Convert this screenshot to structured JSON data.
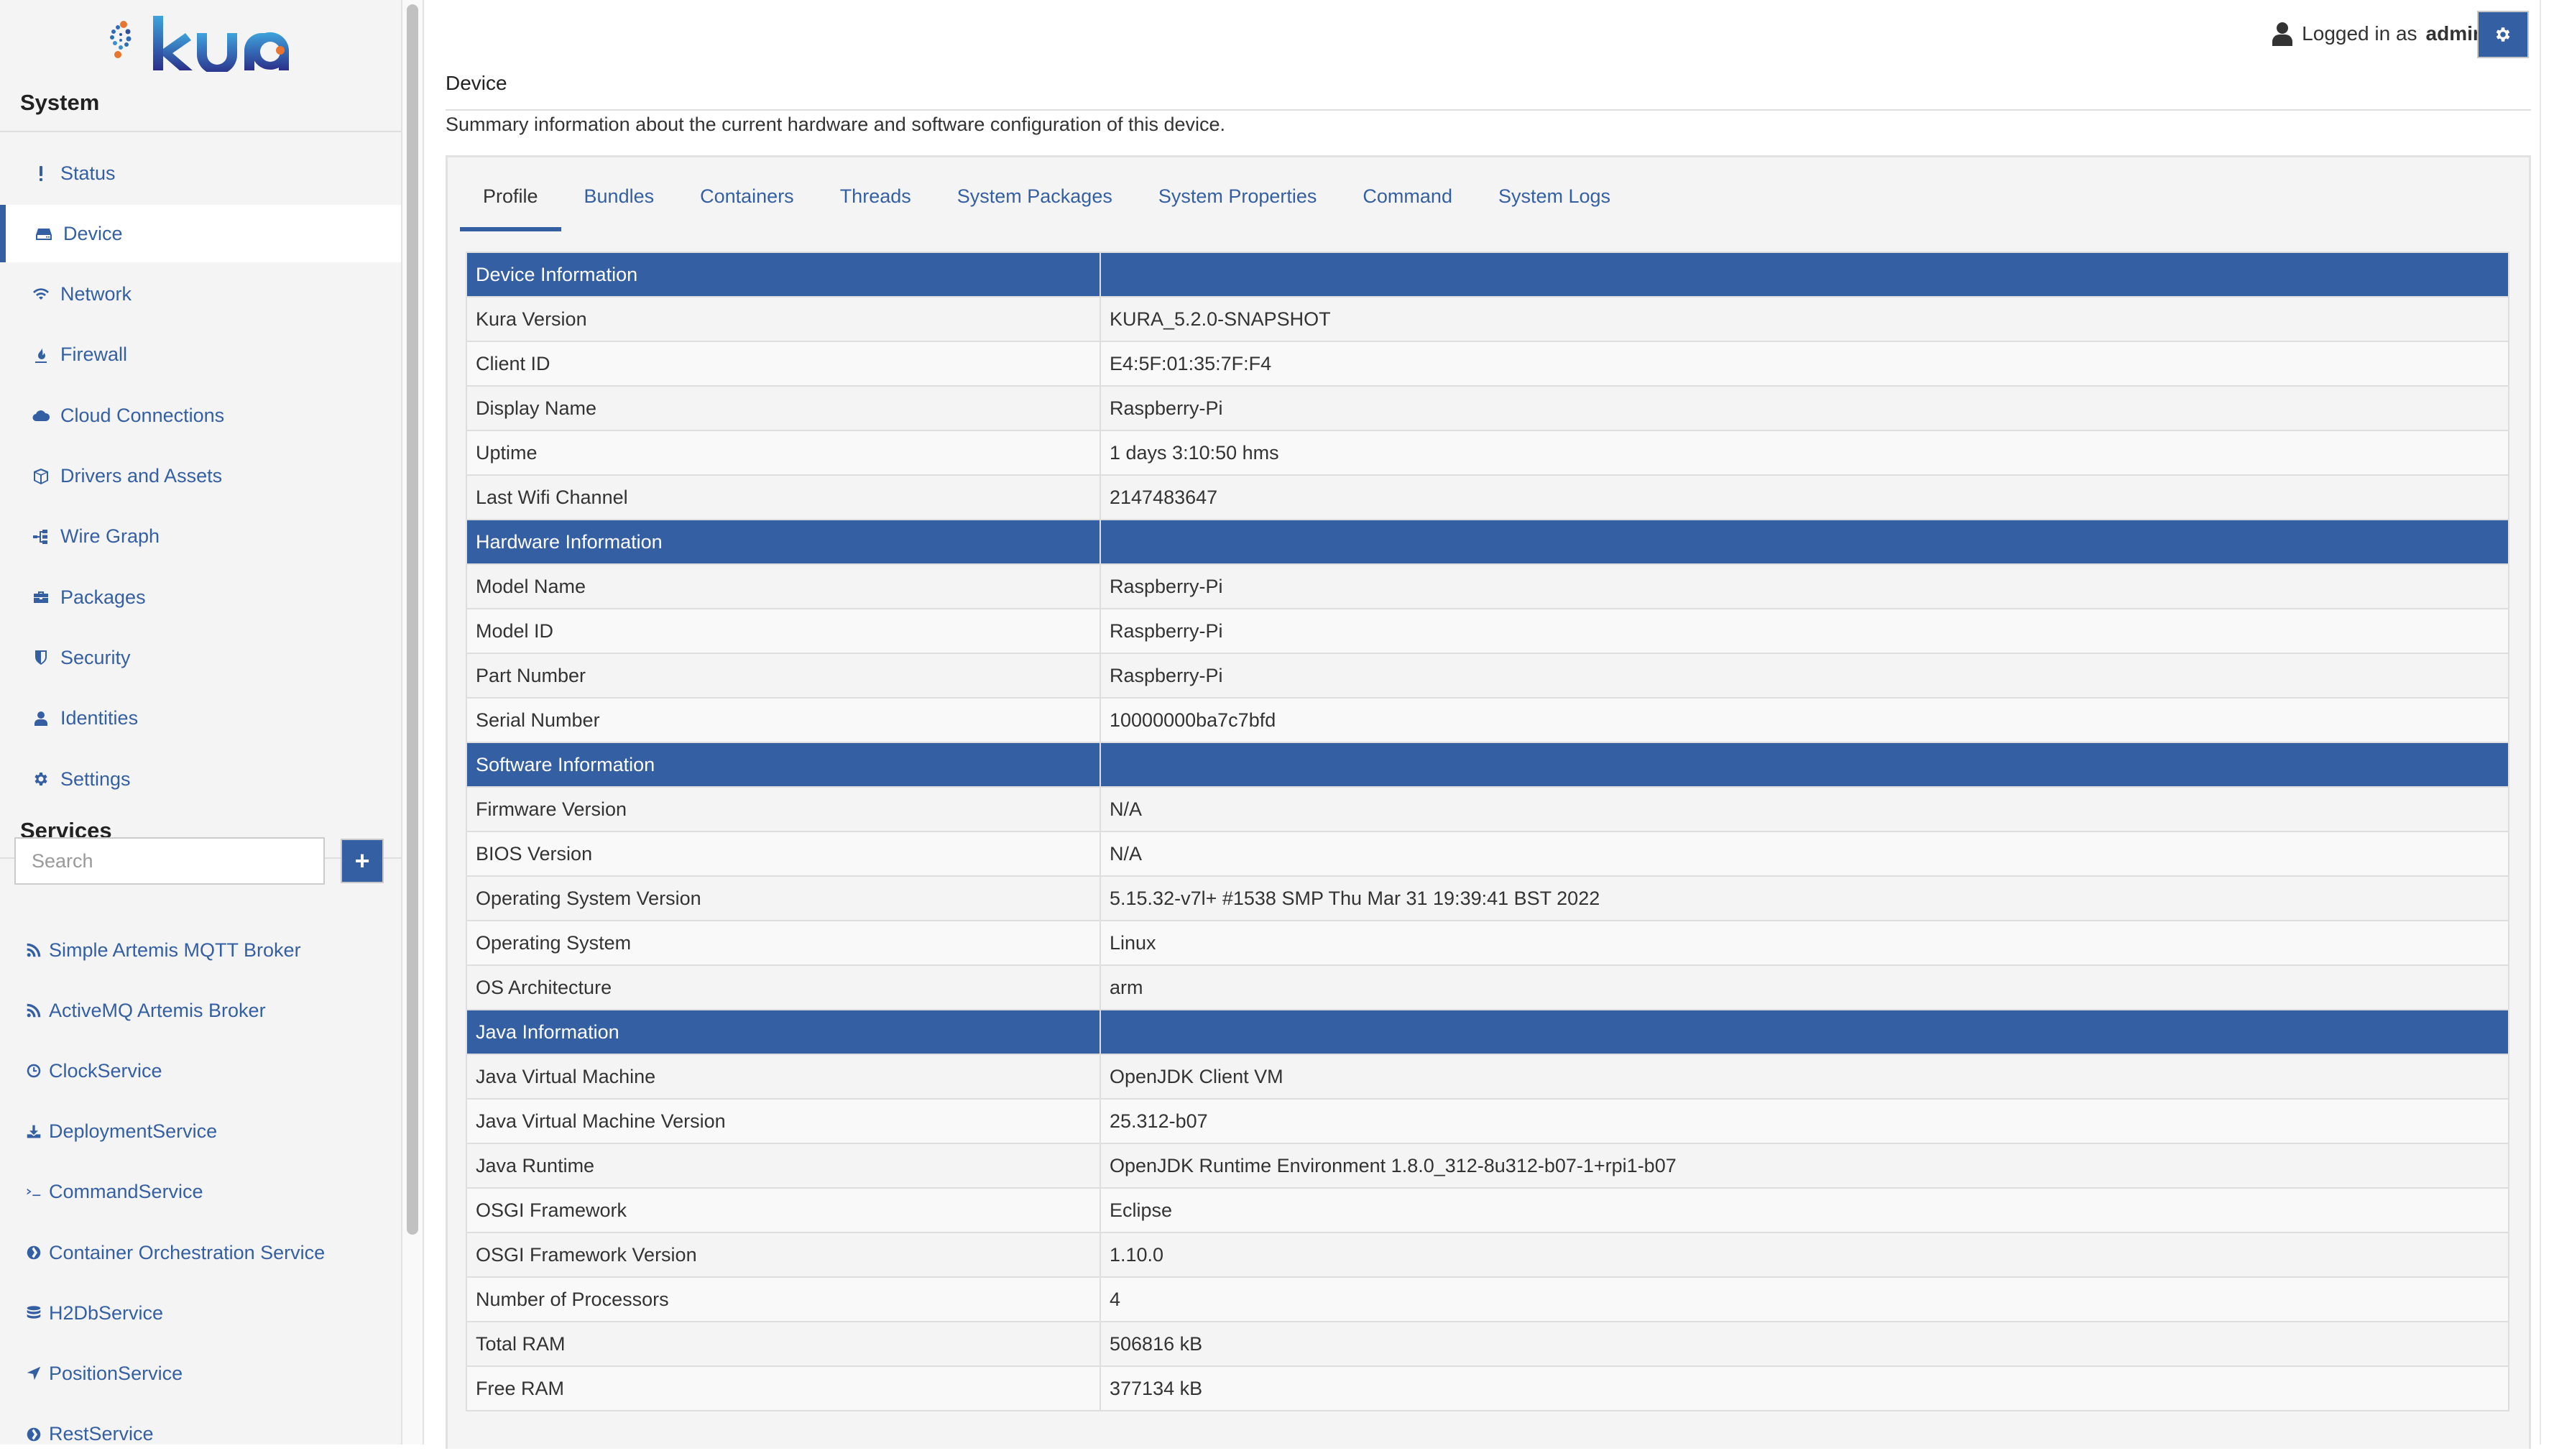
{
  "brand": {
    "name": "kura",
    "accent": "#355fa3"
  },
  "sidebar": {
    "system_title": "System",
    "system_items": [
      {
        "label": "Status",
        "icon": "exclamation-icon",
        "active": false
      },
      {
        "label": "Device",
        "icon": "hdd-icon",
        "active": true
      },
      {
        "label": "Network",
        "icon": "wifi-icon",
        "active": false
      },
      {
        "label": "Firewall",
        "icon": "fire-icon",
        "active": false
      },
      {
        "label": "Cloud Connections",
        "icon": "cloud-icon",
        "active": false
      },
      {
        "label": "Drivers and Assets",
        "icon": "cube-icon",
        "active": false
      },
      {
        "label": "Wire Graph",
        "icon": "sitemap-icon",
        "active": false
      },
      {
        "label": "Packages",
        "icon": "briefcase-icon",
        "active": false
      },
      {
        "label": "Security",
        "icon": "shield-icon",
        "active": false
      },
      {
        "label": "Identities",
        "icon": "user-icon",
        "active": false
      },
      {
        "label": "Settings",
        "icon": "gear-icon",
        "active": false
      }
    ],
    "services_title": "Services",
    "search_placeholder": "Search",
    "add_button_label": "+",
    "services": [
      {
        "label": "Simple Artemis MQTT Broker",
        "icon": "rss-icon"
      },
      {
        "label": "ActiveMQ Artemis Broker",
        "icon": "rss-icon"
      },
      {
        "label": "ClockService",
        "icon": "clock-icon"
      },
      {
        "label": "DeploymentService",
        "icon": "download-icon"
      },
      {
        "label": "CommandService",
        "icon": "terminal-icon"
      },
      {
        "label": "Container Orchestration Service",
        "icon": "chevron-circle-icon"
      },
      {
        "label": "H2DbService",
        "icon": "database-icon"
      },
      {
        "label": "PositionService",
        "icon": "location-arrow-icon"
      },
      {
        "label": "RestService",
        "icon": "chevron-circle-icon"
      }
    ]
  },
  "header": {
    "logged_in_prefix": "Logged in as",
    "username": "admin"
  },
  "main": {
    "title": "Device",
    "description": "Summary information about the current hardware and software configuration of this device.",
    "tabs": [
      {
        "label": "Profile",
        "active": true
      },
      {
        "label": "Bundles",
        "active": false
      },
      {
        "label": "Containers",
        "active": false
      },
      {
        "label": "Threads",
        "active": false
      },
      {
        "label": "System Packages",
        "active": false
      },
      {
        "label": "System Properties",
        "active": false
      },
      {
        "label": "Command",
        "active": false
      },
      {
        "label": "System Logs",
        "active": false
      }
    ],
    "sections": [
      {
        "title": "Device Information",
        "rows": [
          [
            "Kura Version",
            "KURA_5.2.0-SNAPSHOT"
          ],
          [
            "Client ID",
            "E4:5F:01:35:7F:F4"
          ],
          [
            "Display Name",
            "Raspberry-Pi"
          ],
          [
            "Uptime",
            "1 days 3:10:50 hms"
          ],
          [
            "Last Wifi Channel",
            "2147483647"
          ]
        ]
      },
      {
        "title": "Hardware Information",
        "rows": [
          [
            "Model Name",
            "Raspberry-Pi"
          ],
          [
            "Model ID",
            "Raspberry-Pi"
          ],
          [
            "Part Number",
            "Raspberry-Pi"
          ],
          [
            "Serial Number",
            "10000000ba7c7bfd"
          ]
        ]
      },
      {
        "title": "Software Information",
        "rows": [
          [
            "Firmware Version",
            "N/A"
          ],
          [
            "BIOS Version",
            "N/A"
          ],
          [
            "Operating System Version",
            "5.15.32-v7l+ #1538 SMP Thu Mar 31 19:39:41 BST 2022"
          ],
          [
            "Operating System",
            "Linux"
          ],
          [
            "OS Architecture",
            "arm"
          ]
        ]
      },
      {
        "title": "Java Information",
        "rows": [
          [
            "Java Virtual Machine",
            "OpenJDK Client VM"
          ],
          [
            "Java Virtual Machine Version",
            "25.312-b07"
          ],
          [
            "Java Runtime",
            "OpenJDK Runtime Environment 1.8.0_312-8u312-b07-1+rpi1-b07"
          ],
          [
            "OSGI Framework",
            "Eclipse"
          ],
          [
            "OSGI Framework Version",
            "1.10.0"
          ],
          [
            "Number of Processors",
            "4"
          ],
          [
            "Total RAM",
            "506816 kB"
          ],
          [
            "Free RAM",
            "377134 kB"
          ]
        ]
      }
    ]
  }
}
